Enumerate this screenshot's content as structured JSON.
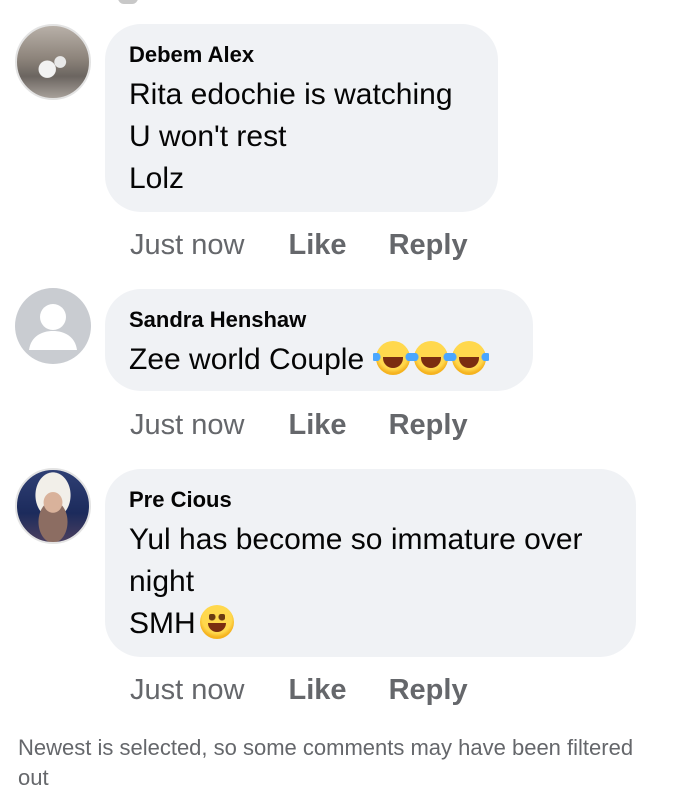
{
  "comments": [
    {
      "author": "Debem Alex",
      "lines": [
        "Rita edochie is watching",
        "U won't rest",
        "Lolz"
      ],
      "time": "Just now",
      "like_label": "Like",
      "reply_label": "Reply",
      "avatar": "profile-photo"
    },
    {
      "author": "Sandra Henshaw",
      "lines": [
        "Zee world Couple"
      ],
      "emojis": [
        "face-with-tears-of-joy",
        "face-with-tears-of-joy",
        "face-with-tears-of-joy"
      ],
      "time": "Just now",
      "like_label": "Like",
      "reply_label": "Reply",
      "avatar": "default-profile-icon"
    },
    {
      "author": "Pre Cious",
      "lines": [
        "Yul has become so immature over",
        "night",
        "SMH"
      ],
      "emojis": [
        "grinning-face"
      ],
      "time": "Just now",
      "like_label": "Like",
      "reply_label": "Reply",
      "avatar": "profile-photo"
    }
  ],
  "footer_note": "Newest is selected, so some comments may have been filtered out",
  "colors": {
    "bubble": "#f0f2f5",
    "text": "#050505",
    "secondary": "#65676b",
    "background": "#ffffff"
  }
}
